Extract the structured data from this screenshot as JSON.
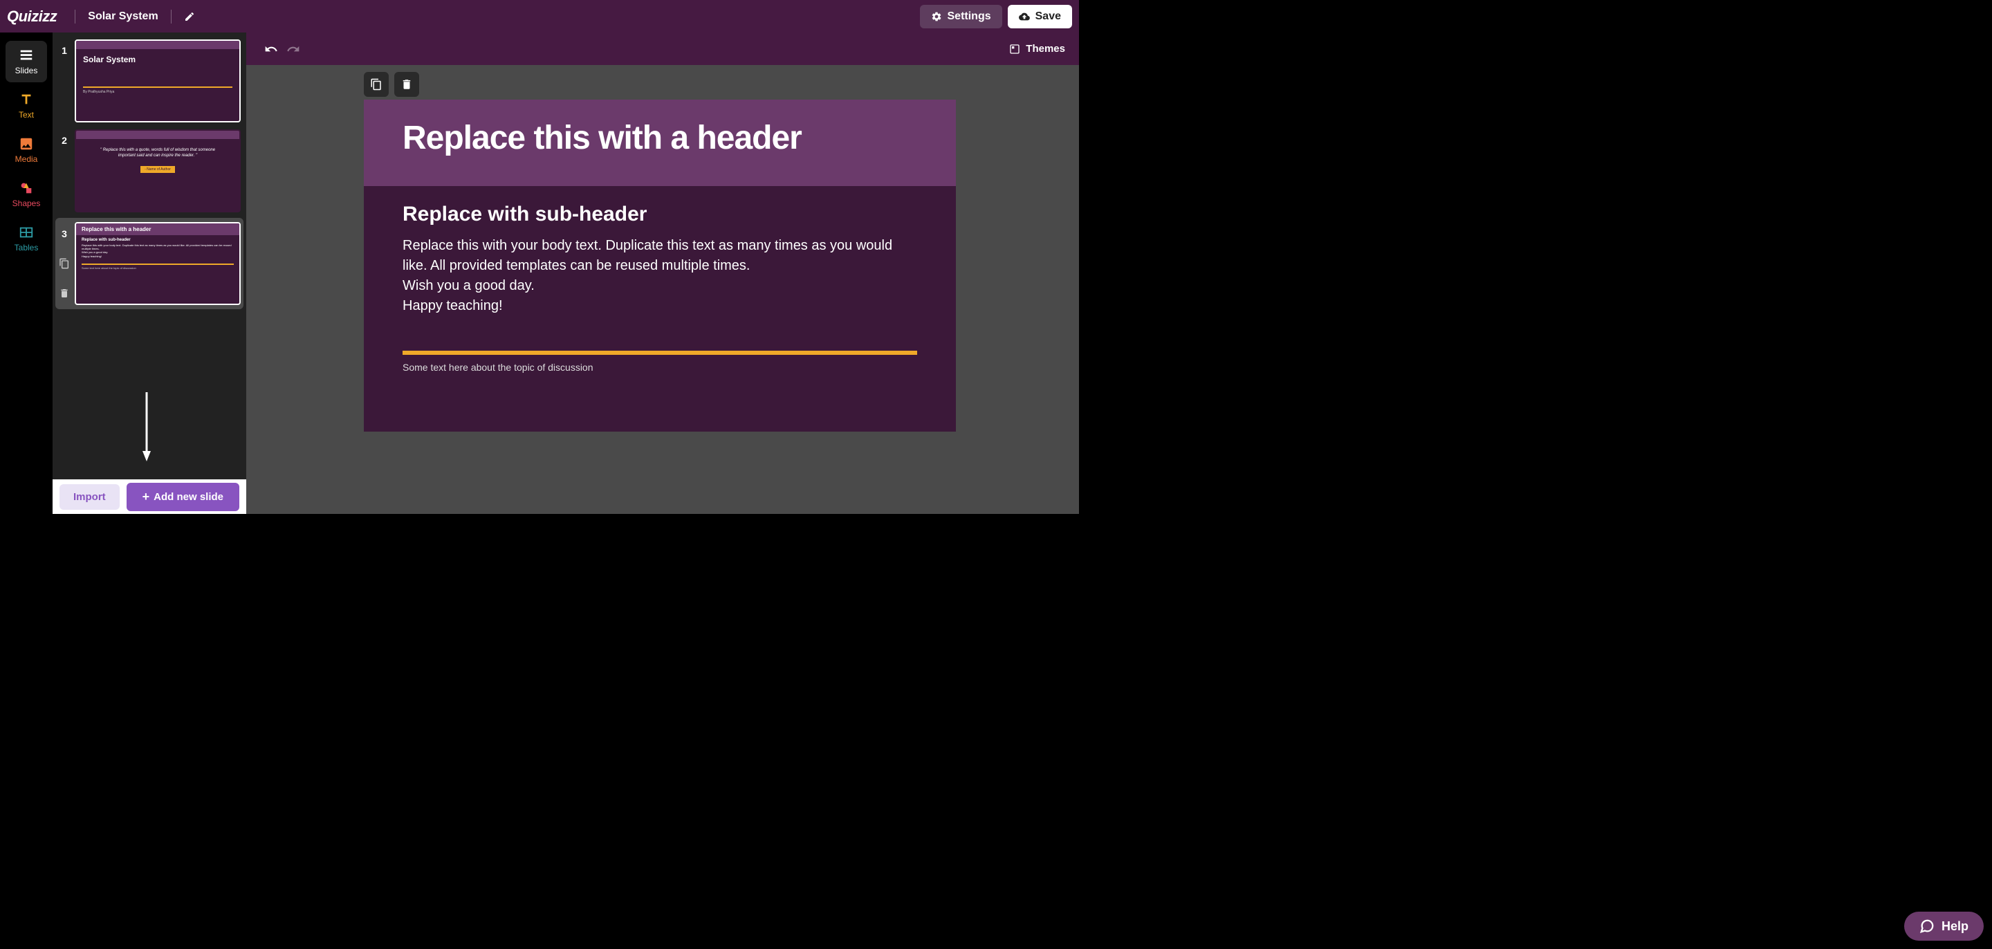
{
  "app": {
    "name": "Quizizz",
    "title": "Solar System"
  },
  "topbar": {
    "settings": "Settings",
    "save": "Save"
  },
  "tools": [
    {
      "name": "slides",
      "label": "Slides",
      "color": "#fff",
      "active": true
    },
    {
      "name": "text",
      "label": "Text",
      "color": "#EFA929"
    },
    {
      "name": "media",
      "label": "Media",
      "color": "#EF7B3A"
    },
    {
      "name": "shapes",
      "label": "Shapes",
      "color": "#E84A5F"
    },
    {
      "name": "tables",
      "label": "Tables",
      "color": "#2D9DA6"
    }
  ],
  "slides": [
    {
      "num": "1",
      "title": "Solar System",
      "author": "By Prathyusha Priya"
    },
    {
      "num": "2",
      "quote": "\" Replace this with a quote, words full of wisdom that someone important said and can inspire the reader. \"",
      "author": "- Name of Author"
    },
    {
      "num": "3",
      "header": "Replace this with a header",
      "sub": "Replace with sub-header",
      "body": "Replace this with your body text. Duplicate this text as many times as you would like. All provided templates can be reused multiple times.\nWish you a good day.\nHappy teaching!",
      "footer": "Some text here about the topic of discussion"
    }
  ],
  "footer": {
    "import": "Import",
    "add": "Add new slide"
  },
  "toolbar": {
    "themes": "Themes"
  },
  "mainSlide": {
    "header": "Replace this with a header",
    "sub": "Replace with sub-header",
    "body1": "Replace this with your body text. Duplicate this text as many times as you would like. All provided templates can be reused multiple times.",
    "body2": "Wish you a good day.",
    "body3": "Happy teaching!",
    "footer": "Some text here about the topic of discussion"
  },
  "help": "Help"
}
